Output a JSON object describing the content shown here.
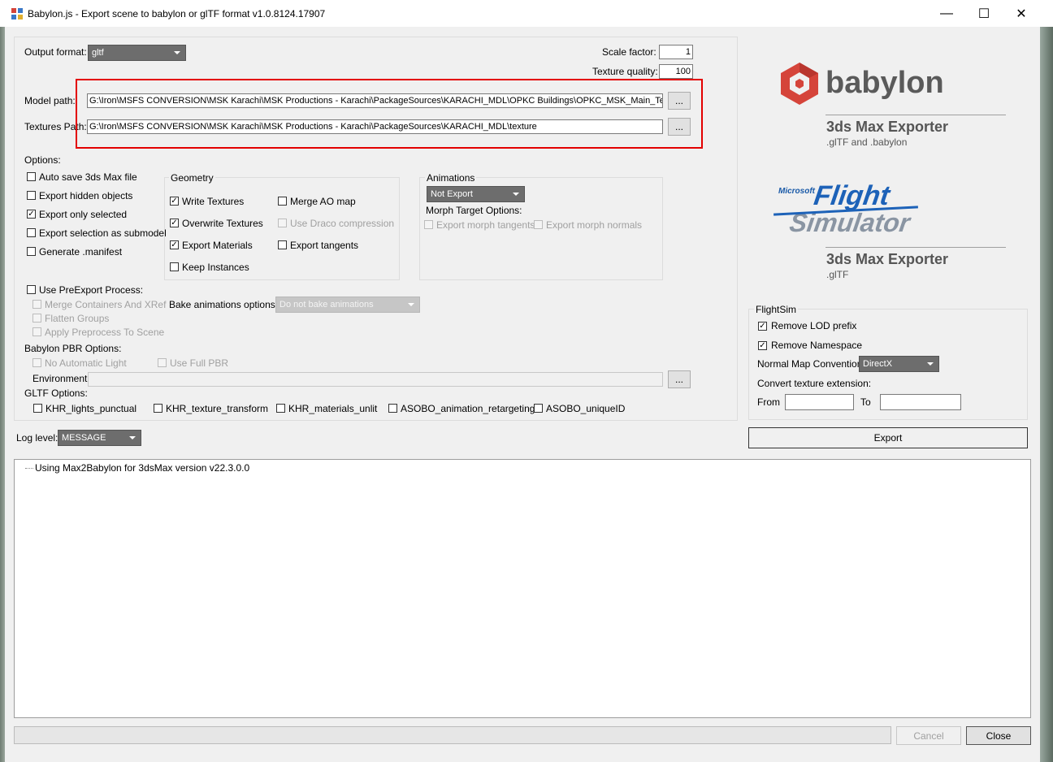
{
  "window": {
    "title": "Babylon.js - Export scene to babylon or glTF format v1.0.8124.17907",
    "minimize": "—",
    "maximize": "☐",
    "close": "✕"
  },
  "output": {
    "format_label": "Output format:",
    "format_value": "gltf",
    "scale_label": "Scale factor:",
    "scale_value": "1",
    "texture_quality_label": "Texture quality:",
    "texture_quality_value": "100"
  },
  "paths": {
    "model_label": "Model path:",
    "model_value": "G:\\Iron\\MSFS CONVERSION\\MSK Karachi\\MSK Productions - Karachi\\PackageSources\\KARACHI_MDL\\OPKC Buildings\\OPKC_MSK_Main_Terminal",
    "textures_label": "Textures Path:",
    "textures_value": "G:\\Iron\\MSFS CONVERSION\\MSK Karachi\\MSK Productions - Karachi\\PackageSources\\KARACHI_MDL\\texture",
    "browse": "..."
  },
  "options": {
    "label": "Options:",
    "items": [
      {
        "label": "Auto save 3ds Max file",
        "checked": false
      },
      {
        "label": "Export hidden objects",
        "checked": false
      },
      {
        "label": "Export only selected",
        "checked": true
      },
      {
        "label": "Export selection as submodel",
        "checked": false
      },
      {
        "label": "Generate .manifest",
        "checked": false
      }
    ]
  },
  "geometry": {
    "title": "Geometry",
    "write_textures": "Write Textures",
    "overwrite_textures": "Overwrite Textures",
    "export_materials": "Export Materials",
    "keep_instances": "Keep Instances",
    "merge_ao": "Merge AO map",
    "draco": "Use Draco compression",
    "export_tangents": "Export tangents"
  },
  "animations": {
    "title": "Animations",
    "value": "Not Export",
    "morph_label": "Morph Target Options:",
    "morph_tangents": "Export morph tangents",
    "morph_normals": "Export morph normals"
  },
  "preexport": {
    "label": "Use PreExport Process:",
    "merge": "Merge Containers And XRef",
    "flatten": "Flatten Groups",
    "preprocess": "Apply Preprocess To Scene",
    "bake_label": "Bake animations options:",
    "bake_value": "Do not bake animations"
  },
  "pbr": {
    "label": "Babylon PBR Options:",
    "no_auto_light": "No Automatic Light",
    "full_pbr": "Use Full PBR",
    "environment_label": "Environment",
    "environment_value": ""
  },
  "gltf_options": {
    "label": "GLTF Options:",
    "items": [
      "KHR_lights_punctual",
      "KHR_texture_transform",
      "KHR_materials_unlit",
      "ASOBO_animation_retargeting",
      "ASOBO_uniqueID"
    ]
  },
  "log": {
    "level_label": "Log level:",
    "level_value": "MESSAGE",
    "lines": [
      "Using Max2Babylon for 3dsMax version v22.3.0.0"
    ]
  },
  "logos": {
    "babylon_wordmark": "babylon",
    "babylon_caption": "3ds Max Exporter",
    "babylon_sub": ".glTF and .babylon",
    "msfs_microsoft": "Microsoft",
    "msfs_flight": "Flight",
    "msfs_simulator": "Simulator",
    "msfs_caption": "3ds Max Exporter",
    "msfs_sub": ".glTF"
  },
  "flightsim": {
    "title": "FlightSim",
    "remove_lod": "Remove LOD prefix",
    "remove_namespace": "Remove Namespace",
    "normal_map_label": "Normal Map Convention",
    "normal_map_value": "DirectX",
    "convert_label": "Convert texture extension:",
    "from_label": "From",
    "to_label": "To",
    "from_value": "",
    "to_value": ""
  },
  "actions": {
    "export": "Export",
    "cancel": "Cancel",
    "close": "Close"
  },
  "colors": {
    "highlight_box": "#e30000",
    "babylon_red": "#d5443a",
    "text_gray": "#555555"
  }
}
